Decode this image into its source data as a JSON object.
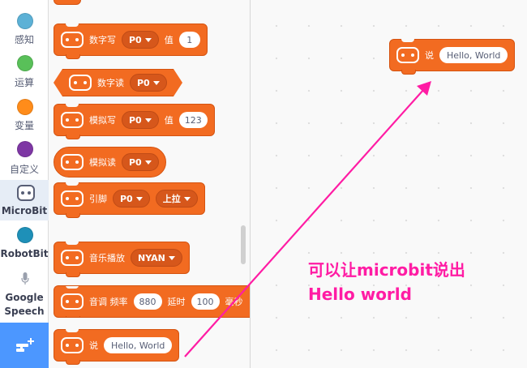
{
  "categories": [
    {
      "label": "感知",
      "color": "#5cb1d6"
    },
    {
      "label": "运算",
      "color": "#59c059"
    },
    {
      "label": "变量",
      "color": "#ff8c1a"
    },
    {
      "label": "自定义",
      "color": "#7e37a4"
    },
    {
      "label": "MicroBit",
      "selected": true
    },
    {
      "label": "RobotBit",
      "color": "#1e90b8"
    },
    {
      "label": "Google Speech"
    }
  ],
  "extension_button_icon": "add-extension-icon",
  "palette": {
    "digital_write": {
      "label": "数字写",
      "pin": "P0",
      "value_label": "值",
      "value": "1"
    },
    "digital_read": {
      "label": "数字读",
      "pin": "P0"
    },
    "analog_write": {
      "label": "模拟写",
      "pin": "P0",
      "value_label": "值",
      "value": "123"
    },
    "analog_read": {
      "label": "模拟读",
      "pin": "P0"
    },
    "pin_pull": {
      "label": "引脚",
      "pin": "P0",
      "mode": "上拉"
    },
    "play_music": {
      "label": "音乐播放",
      "song": "NYAN"
    },
    "play_tone": {
      "label": "音调 频率",
      "freq": "880",
      "delay_label": "延时",
      "delay": "100",
      "unit": "毫秒"
    },
    "say": {
      "label": "说",
      "text": "Hello, World"
    }
  },
  "workspace": {
    "say_block": {
      "label": "说",
      "text": "Hello, World"
    }
  },
  "annotation": {
    "line1": "可以让microbit说出",
    "line2": "Hello world",
    "color": "#ff1ca4"
  },
  "block_color": "#f26b21"
}
